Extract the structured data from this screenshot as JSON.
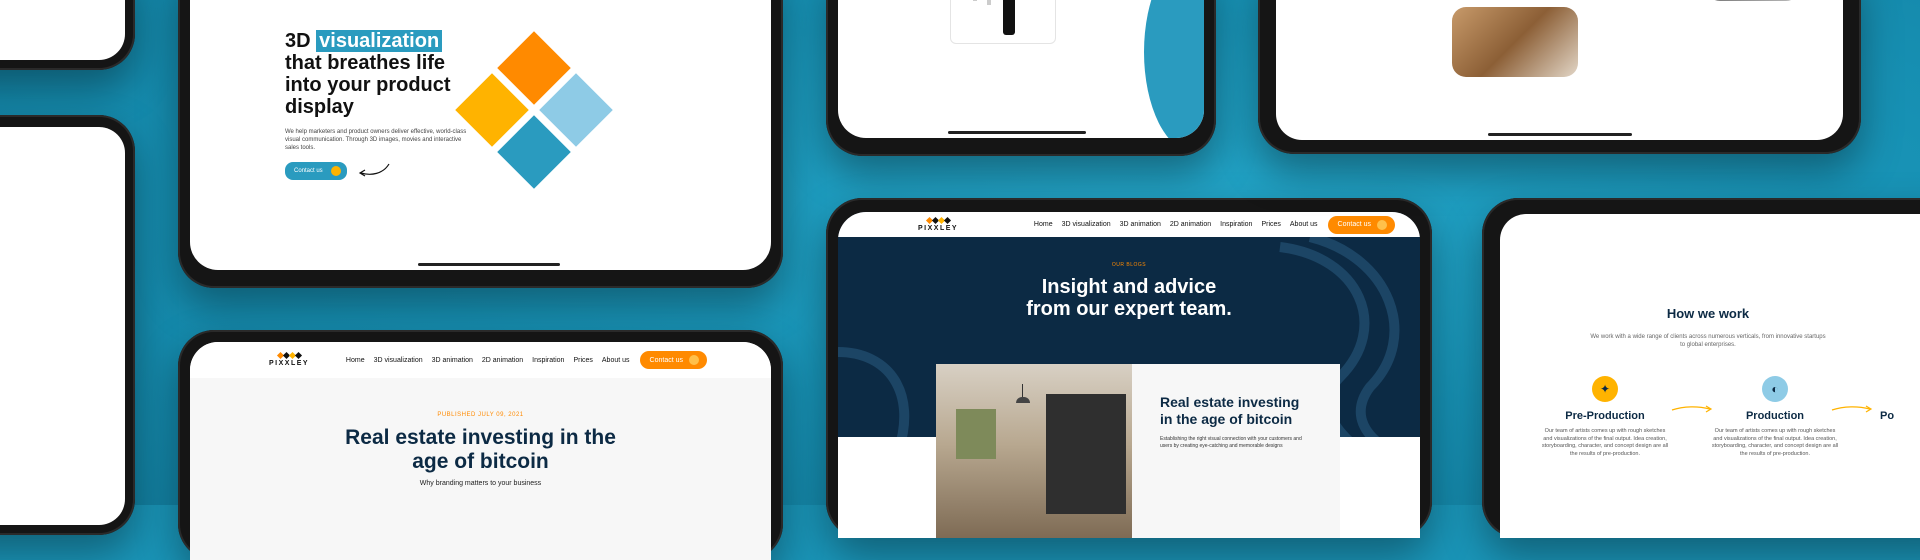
{
  "hero": {
    "title_num": "3D",
    "title_highlight": "visualization",
    "title_line2": "that breathes life",
    "title_line3": "into your product",
    "title_line4": "display",
    "description": "We help marketers and product owners deliver effective, world-class visual communication. Through 3D images, movies and interactive sales tools.",
    "cta": "Contact us"
  },
  "nav": {
    "logo_text": "PIXXLEY",
    "links": [
      "Home",
      "3D visualization",
      "3D animation",
      "2D animation",
      "Inspiration",
      "Prices",
      "About us"
    ],
    "cta": "Contact us"
  },
  "article": {
    "kicker": "PUBLISHED JULY 09, 2021",
    "title": "Real estate investing in the age of bitcoin",
    "subtitle": "Why branding matters to your business"
  },
  "blog": {
    "kicker": "OUR BLOGS",
    "title_line1": "Insight and advice",
    "title_line2": "from our expert team.",
    "card_title": "Real estate investing in the age of bitcoin",
    "card_text": "Establishing the right visual connection with your customers and users by creating eye-catching and memorable designs"
  },
  "process": {
    "title": "How we work",
    "intro": "We work with a wide range of clients across numerous verticals, from innovative startups to global enterprises.",
    "steps": [
      {
        "title": "Pre-Production",
        "text": "Our team of artists comes up with rough sketches and visualizations of the final output. Idea creation, storyboarding, character, and concept design are all the results of pre-production."
      },
      {
        "title": "Production",
        "text": "Our team of artists comes up with rough sketches and visualizations of the final output. Idea creation, storyboarding, character, and concept design are all the results of pre-production."
      },
      {
        "title": "Po"
      }
    ]
  },
  "colors": {
    "background": "#1a95b8",
    "orange": "#ff8a00",
    "yellow": "#ffb300",
    "teal": "#2a9bbf",
    "light_blue": "#8ecbe6",
    "navy": "#0c2a44"
  }
}
